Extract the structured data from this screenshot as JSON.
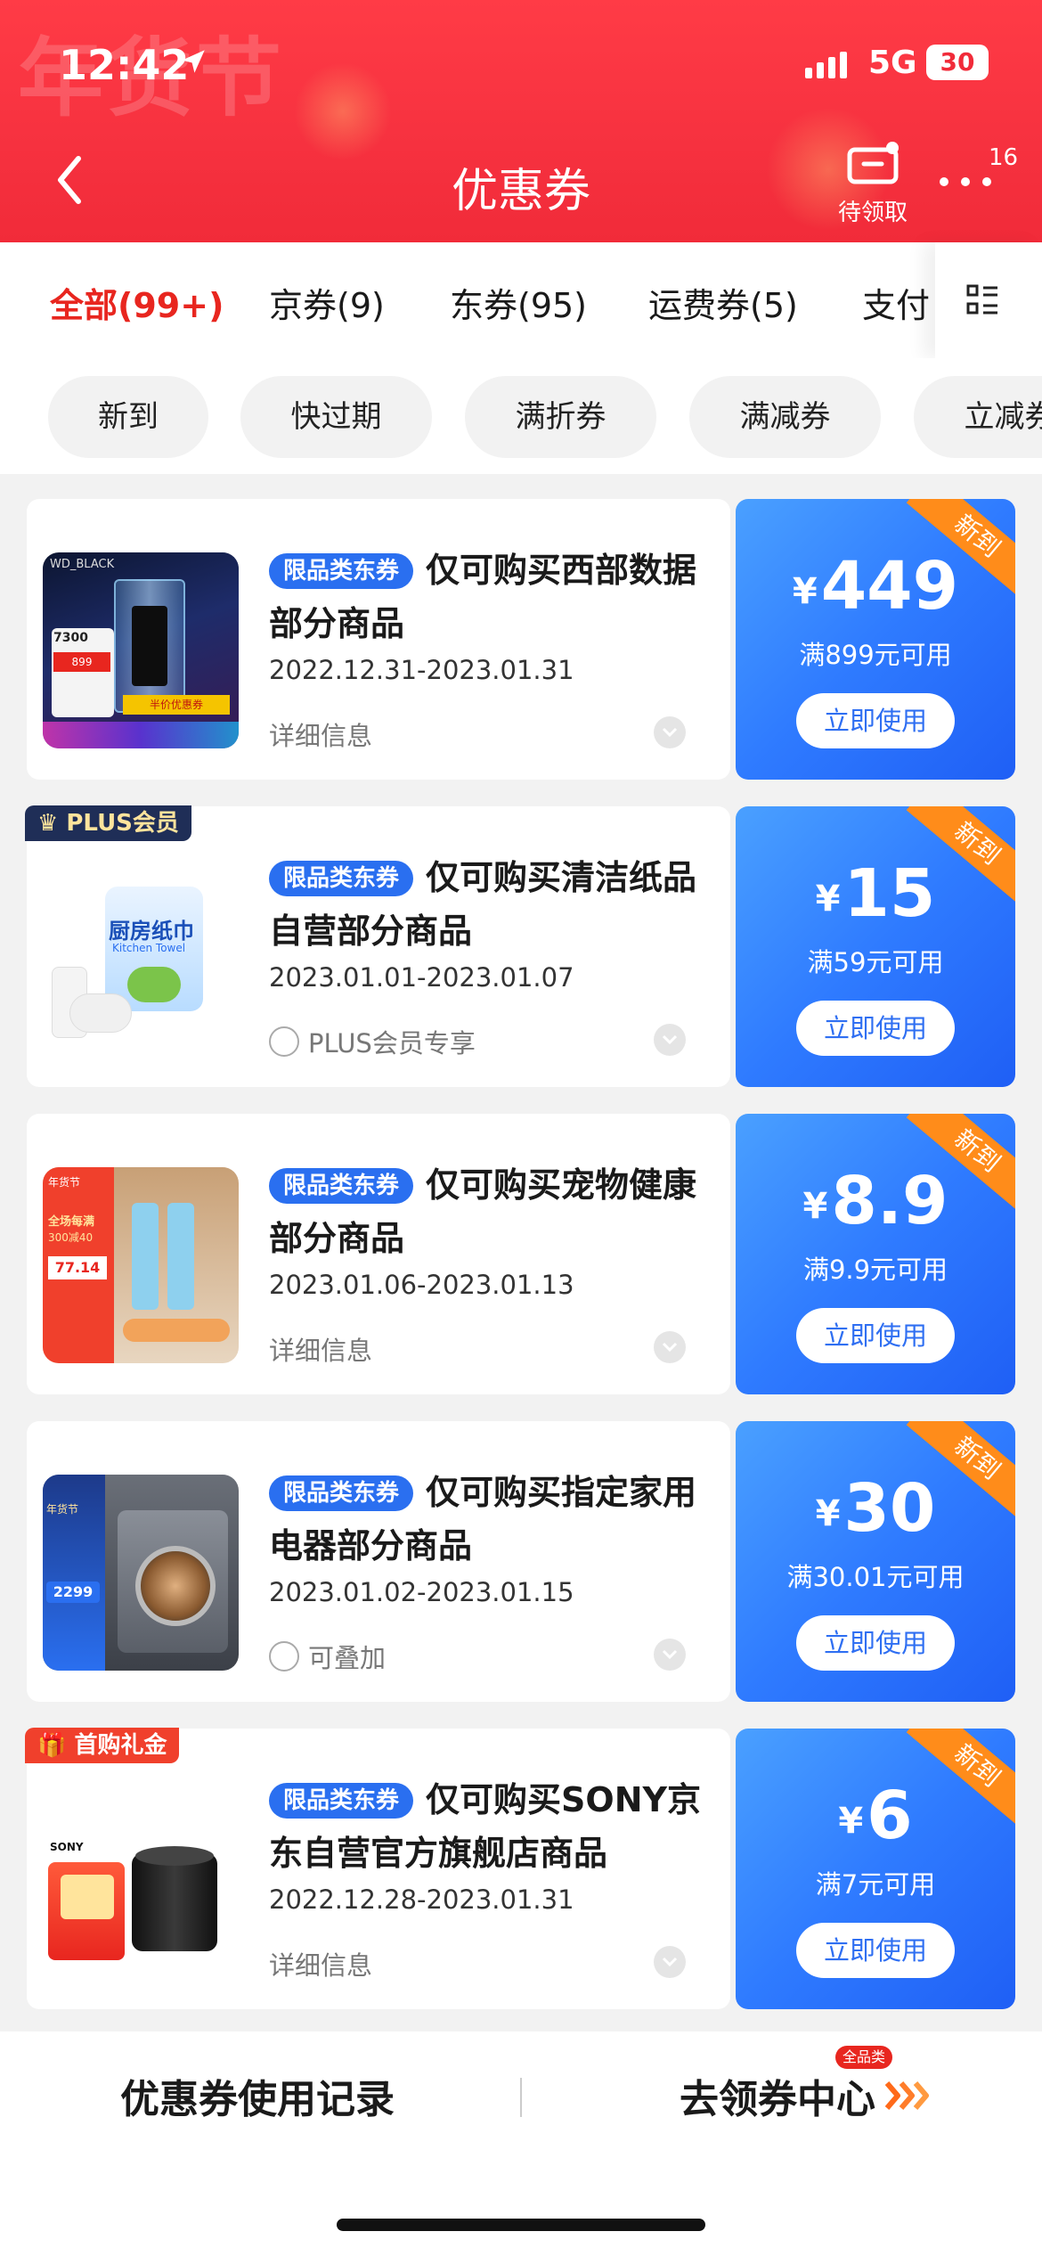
{
  "status": {
    "time": "12:42",
    "network": "5G",
    "battery": "30"
  },
  "header": {
    "decor_text": "年货节",
    "title": "优惠券",
    "pending_label": "待领取",
    "more_badge": "16"
  },
  "tabs": [
    {
      "label": "全部(99+)",
      "active": true
    },
    {
      "label": "京券(9)",
      "active": false
    },
    {
      "label": "东券(95)",
      "active": false
    },
    {
      "label": "运费券(5)",
      "active": false
    },
    {
      "label": "支付",
      "active": false
    }
  ],
  "filters": [
    "新到",
    "快过期",
    "满折券",
    "满减券",
    "立减券"
  ],
  "coupons": [
    {
      "tag": "限品类东券",
      "title": "仅可购买西部数据部分商品",
      "date": "2022.12.31-2023.01.31",
      "info": "详细信息",
      "amount": "449",
      "condition": "满899元可用",
      "button": "立即使用",
      "new_label": "新到",
      "ribbon": "",
      "image_labels": [
        "WD_BLACK",
        "7300",
        "半价优惠券",
        "899"
      ]
    },
    {
      "tag": "限品类东券",
      "title": "仅可购买清洁纸品自营部分商品",
      "date": "2023.01.01-2023.01.07",
      "info": "PLUS会员专享",
      "amount": "15",
      "condition": "满59元可用",
      "button": "立即使用",
      "new_label": "新到",
      "ribbon": "PLUS会员",
      "image_labels": [
        "厨房纸巾",
        "Kitchen Towel"
      ]
    },
    {
      "tag": "限品类东券",
      "title": "仅可购买宠物健康部分商品",
      "date": "2023.01.06-2023.01.13",
      "info": "详细信息",
      "amount": "8.9",
      "condition": "满9.9元可用",
      "button": "立即使用",
      "new_label": "新到",
      "ribbon": "",
      "image_labels": [
        "年货节",
        "全场每满",
        "300减40",
        "77.14"
      ]
    },
    {
      "tag": "限品类东券",
      "title": "仅可购买指定家用电器部分商品",
      "date": "2023.01.02-2023.01.15",
      "info": "可叠加",
      "amount": "30",
      "condition": "满30.01元可用",
      "button": "立即使用",
      "new_label": "新到",
      "ribbon": "",
      "image_labels": [
        "2299",
        "年货节"
      ]
    },
    {
      "tag": "限品类东券",
      "title": "仅可购买SONY京东自营官方旗舰店商品",
      "date": "2022.12.28-2023.01.31",
      "info": "详细信息",
      "amount": "6",
      "condition": "满7元可用",
      "button": "立即使用",
      "new_label": "新到",
      "ribbon": "首购礼金",
      "image_labels": [
        "SONY"
      ]
    }
  ],
  "bottom": {
    "records_label": "优惠券使用记录",
    "center_label": "去领券中心",
    "hot_badge": "全品类"
  },
  "colors": {
    "header_red": "#f6313f",
    "active_tab": "#e8261f",
    "coupon_blue": "#2f7bff",
    "new_orange": "#ff8c1a",
    "tag_blue": "#2a6ff0",
    "plus_navy": "#1f2e57"
  }
}
